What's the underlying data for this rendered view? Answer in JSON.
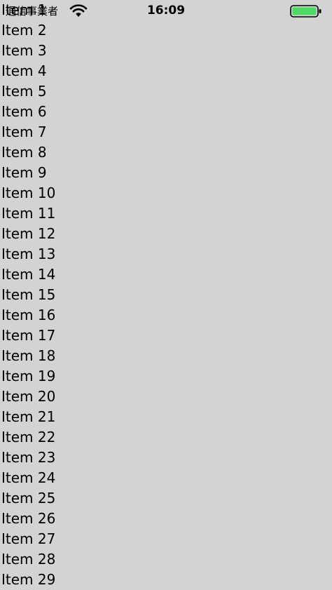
{
  "status_bar": {
    "carrier": "通信事業者",
    "time": "16:09",
    "battery_color": "#4cd964",
    "wifi_icon": "wifi-icon",
    "battery_icon": "battery-icon"
  },
  "list": {
    "items": [
      "Item 1",
      "Item 2",
      "Item 3",
      "Item 4",
      "Item 5",
      "Item 6",
      "Item 7",
      "Item 8",
      "Item 9",
      "Item 10",
      "Item 11",
      "Item 12",
      "Item 13",
      "Item 14",
      "Item 15",
      "Item 16",
      "Item 17",
      "Item 18",
      "Item 19",
      "Item 20",
      "Item 21",
      "Item 22",
      "Item 23",
      "Item 24",
      "Item 25",
      "Item 26",
      "Item 27",
      "Item 28",
      "Item 29"
    ]
  }
}
